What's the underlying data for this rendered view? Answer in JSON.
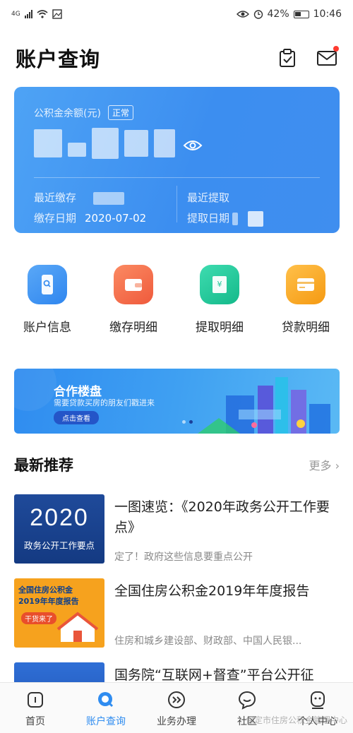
{
  "status_bar": {
    "network": "4G",
    "battery_percent": "42%",
    "time": "10:46"
  },
  "header": {
    "title": "账户查询"
  },
  "balance_card": {
    "label": "公积金余额(元)",
    "status": "正常",
    "last_deposit_label": "最近缴存",
    "deposit_date_label": "缴存日期",
    "deposit_date": "2020-07-02",
    "last_withdraw_label": "最近提取",
    "withdraw_date_label": "提取日期"
  },
  "quick_actions": [
    {
      "label": "账户信息",
      "color": "#3a8ff0",
      "icon": "phone-search-icon"
    },
    {
      "label": "缴存明细",
      "color": "#f26a4a",
      "icon": "wallet-icon"
    },
    {
      "label": "提取明细",
      "color": "#1fc79a",
      "icon": "withdraw-card-icon"
    },
    {
      "label": "贷款明细",
      "color": "#f6a623",
      "icon": "loan-card-icon"
    }
  ],
  "banner": {
    "title": "合作楼盘",
    "subtitle": "需要贷款买房的朋友们戳进来",
    "button": "点击查看"
  },
  "recommend": {
    "title": "最新推荐",
    "more": "更多 ›"
  },
  "news": [
    {
      "title": "一图速览：《2020年政务公开工作要点》",
      "summary": "定了！政府这些信息要重点公开",
      "thumb_big": "2020",
      "thumb_small": "政务公开工作要点"
    },
    {
      "title": "全国住房公积金2019年年度报告",
      "summary": "住房和城乡建设部、财政部、中国人民银...",
      "thumb_line1": "全国住房公积金",
      "thumb_line2": "2019年年度报告",
      "thumb_tag": "干货来了"
    },
    {
      "title": "国务院“互联网+督查”平台公开征",
      "summary": ""
    }
  ],
  "tabs": [
    {
      "label": "首页",
      "icon": "home-icon"
    },
    {
      "label": "账户查询",
      "icon": "account-search-icon",
      "active": true
    },
    {
      "label": "业务办理",
      "icon": "business-icon"
    },
    {
      "label": "社区",
      "icon": "community-icon"
    },
    {
      "label": "个人中心",
      "icon": "profile-icon"
    }
  ],
  "watermark": "保定市住房公积金管理中心"
}
